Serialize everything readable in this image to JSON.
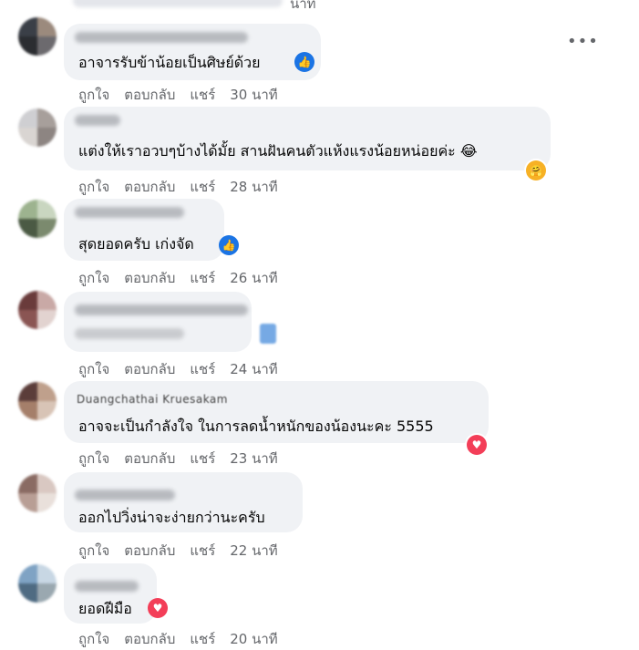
{
  "top_fragment": {
    "time": "นาที"
  },
  "actions": {
    "like": "ถูกใจ",
    "reply": "ตอบกลับ",
    "share": "แชร์"
  },
  "comments": [
    {
      "name": "",
      "text": "อาจารรับข้าน้อยเป็นศิษย์ด้วย",
      "time": "30 นาที",
      "reaction_icon": "like-icon"
    },
    {
      "name": "",
      "text": "แต่งให้เราอวบๆบ้างได้มั้ย สานฝันคนตัวแห้งแรงน้อยหน่อยค่ะ 😂",
      "time": "28 นาที",
      "reaction_icon": "care-icon",
      "reaction_emoji": "🤗"
    },
    {
      "name": "",
      "text": "สุดยอดครับ เก่งจัด",
      "time": "26 นาที",
      "reaction_icon": "like-icon"
    },
    {
      "name": "",
      "text": "",
      "time": "24 นาที"
    },
    {
      "name": "Duangchathai Kruesakam",
      "text": "อาจจะเป็นกำลังใจ ในการลดน้ำหนักของน้องนะคะ 5555",
      "time": "23 นาที",
      "reaction_icon": "love-icon"
    },
    {
      "name": "",
      "text": "ออกไปวิ่งน่าจะง่ายกว่านะครับ",
      "time": "22 นาที"
    },
    {
      "name": "",
      "text": "ยอดฝีมือ",
      "time": "20 นาที",
      "reaction_icon": "love-icon"
    }
  ],
  "colors": {
    "bubble": "#f0f2f5",
    "secondary_text": "#65676b",
    "like_blue": "#1b74e4",
    "love_red": "#f33e58"
  }
}
